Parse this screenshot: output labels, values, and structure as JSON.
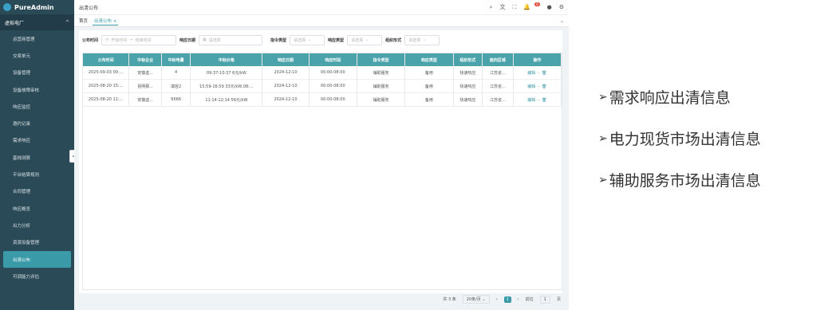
{
  "app": {
    "name": "PureAdmin"
  },
  "sidebar": {
    "group": "虚拟电厂",
    "items": [
      {
        "label": "运营商管理"
      },
      {
        "label": "交易单元"
      },
      {
        "label": "设备管理"
      },
      {
        "label": "设备故障审核"
      },
      {
        "label": "响应监控"
      },
      {
        "label": "邀约记录"
      },
      {
        "label": "需求响应"
      },
      {
        "label": "基线测算"
      },
      {
        "label": "平台结算规则"
      },
      {
        "label": "合同管理"
      },
      {
        "label": "响应概览"
      },
      {
        "label": "出力分析"
      },
      {
        "label": "资源设备管理"
      },
      {
        "label": "出清公布",
        "active": true
      },
      {
        "label": "可调能力评估"
      }
    ],
    "collapse": "«"
  },
  "topbar": {
    "title": "出清公布",
    "notif_count": "9"
  },
  "tabs": {
    "home": "首页",
    "active": "出清公布 ×"
  },
  "filters": {
    "publish_time_label": "公布时间",
    "start_placeholder": "开始时间",
    "sep": "→",
    "end_placeholder": "结束时间",
    "resp_date_label": "响应日期",
    "resp_date_placeholder": "请选择",
    "cmd_type_label": "指令类型",
    "cmd_type_placeholder": "请选择",
    "resp_type_label": "响应类型",
    "resp_type_placeholder": "请选择",
    "org_form_label": "组织形式",
    "org_form_placeholder": "请选择"
  },
  "table": {
    "headers": [
      "公布时间",
      "中标企业",
      "中标电量",
      "中标价格",
      "响应日期",
      "响应时段",
      "指令类型",
      "响应类型",
      "组织形式",
      "面向区域",
      "操作"
    ],
    "rows": [
      [
        "2025-09-03 00:...",
        "安徽虚...",
        "4",
        "09:37-10:37 6元/kW",
        "2024-12-10",
        "00:00-08:00",
        "辅助服务",
        "备用",
        "快速响应",
        "江苏省...",
        "编辑 ··· 🗑"
      ],
      [
        "2025-08-20 15:...",
        "昆明那...",
        "填容2",
        "15:59-16:59 33元/kW,08:...",
        "2024-12-10",
        "00:00-08:00",
        "辅助服务",
        "备用",
        "快速响应",
        "江苏省...",
        "编辑 ··· 🗑"
      ],
      [
        "2025-08-20 11:...",
        "安徽虚...",
        "6666",
        "11:14-12:14 56元/kW",
        "2024-12-10",
        "00:00-08:00",
        "辅助服务",
        "备用",
        "快速响应",
        "江苏省...",
        "编辑 ··· 🗑"
      ]
    ]
  },
  "pager": {
    "total": "共 3 条",
    "size": "20条/页",
    "page": "1",
    "goto_label": "前往",
    "goto_value": "1",
    "goto_unit": "页"
  },
  "bullets": [
    "需求响应出清信息",
    "电力现货市场出清信息",
    "辅助服务市场出清信息"
  ]
}
